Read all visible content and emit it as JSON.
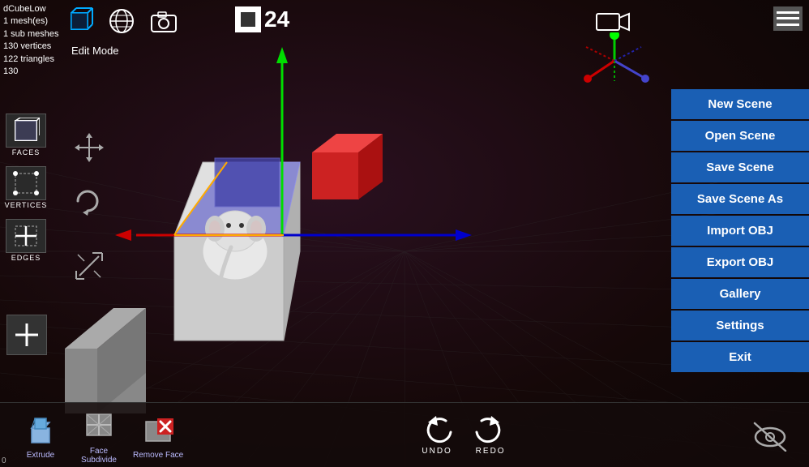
{
  "info": {
    "object_name": "dCubeLow",
    "mesh_count": "1 mesh(es)",
    "sub_mesh": "1 sub meshes",
    "vertices": "130 vertices",
    "triangles": "122 triangles",
    "extra": "130"
  },
  "toolbar": {
    "mode_label": "Edit Mode",
    "frame_count": "24"
  },
  "right_menu": {
    "items": [
      {
        "label": "New Scene",
        "id": "new-scene"
      },
      {
        "label": "Open Scene",
        "id": "open-scene"
      },
      {
        "label": "Save Scene",
        "id": "save-scene"
      },
      {
        "label": "Save Scene As",
        "id": "save-scene-as"
      },
      {
        "label": "Import OBJ",
        "id": "import-obj"
      },
      {
        "label": "Export OBJ",
        "id": "export-obj"
      },
      {
        "label": "Gallery",
        "id": "gallery"
      },
      {
        "label": "Settings",
        "id": "settings"
      },
      {
        "label": "Exit",
        "id": "exit"
      }
    ]
  },
  "left_tools": [
    {
      "label": "FACES",
      "id": "faces"
    },
    {
      "label": "VERTICES",
      "id": "vertices"
    },
    {
      "label": "EDGES",
      "id": "edges"
    }
  ],
  "bottom_tools": [
    {
      "label": "Extrude",
      "id": "extrude"
    },
    {
      "label": "Face\nSubdivide",
      "id": "face-subdivide"
    },
    {
      "label": "Remove Face",
      "id": "remove-face"
    }
  ],
  "undo_label": "UNDO",
  "redo_label": "REDO",
  "coord": "0",
  "icons": {
    "globe": "🌐",
    "camera_snapshot": "📷",
    "video_camera": "🎥",
    "hamburger": "☰",
    "eye_hidden": "👁",
    "plus": "+",
    "undo_arrow": "↺",
    "redo_arrow": "↻",
    "move": "✛",
    "rotate": "↺",
    "scale": "⤢",
    "add": "+"
  }
}
